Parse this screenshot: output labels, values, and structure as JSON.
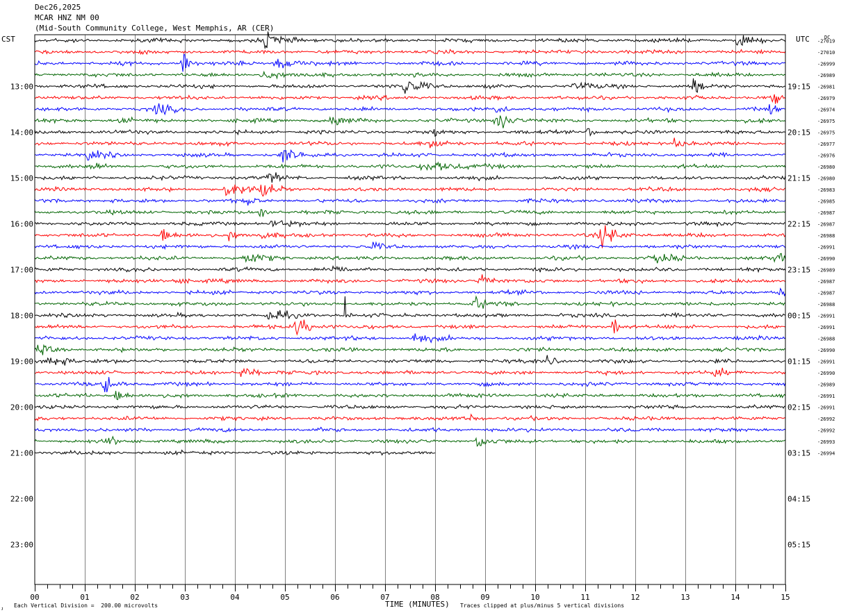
{
  "header": {
    "date": "Dec26,2025",
    "station": "MCAR HNZ NM 00",
    "location": "(Mid-South Community College, West Memphis, AR (CER)"
  },
  "left_axis_label": "CST",
  "right_axis_label": "UTC",
  "dc_label": "DC",
  "footer": {
    "scale_note": "Each Vertical Division =  200.00 microvolts",
    "xlabel": "TIME (MINUTES)",
    "clip_note": "Traces clipped at plus/minus 5 vertical divisions",
    "corner_mark": "ᴊ"
  },
  "colors": {
    "trace_cycle": [
      "#000000",
      "#ff0000",
      "#0000ff",
      "#006400"
    ],
    "grid": "#808080",
    "frame": "#000000"
  },
  "chart_data": {
    "type": "line",
    "title": "",
    "xlabel": "TIME (MINUTES)",
    "xlim": [
      0,
      15
    ],
    "x_ticks": [
      "00",
      "01",
      "02",
      "03",
      "04",
      "05",
      "06",
      "07",
      "08",
      "09",
      "10",
      "11",
      "12",
      "13",
      "14",
      "15"
    ],
    "rows_total": 48,
    "minutes_per_row": 15,
    "left_hour_labels": [
      {
        "row": 4,
        "label": "13:00"
      },
      {
        "row": 8,
        "label": "14:00"
      },
      {
        "row": 12,
        "label": "15:00"
      },
      {
        "row": 16,
        "label": "16:00"
      },
      {
        "row": 20,
        "label": "17:00"
      },
      {
        "row": 24,
        "label": "18:00"
      },
      {
        "row": 28,
        "label": "19:00"
      },
      {
        "row": 32,
        "label": "20:00"
      },
      {
        "row": 36,
        "label": "21:00"
      },
      {
        "row": 40,
        "label": "22:00"
      },
      {
        "row": 44,
        "label": "23:00"
      }
    ],
    "right_hour_labels": [
      {
        "row": 4,
        "label": "19:15"
      },
      {
        "row": 8,
        "label": "20:15"
      },
      {
        "row": 12,
        "label": "21:15"
      },
      {
        "row": 16,
        "label": "22:15"
      },
      {
        "row": 20,
        "label": "23:15"
      },
      {
        "row": 24,
        "label": "00:15"
      },
      {
        "row": 28,
        "label": "01:15"
      },
      {
        "row": 32,
        "label": "02:15"
      },
      {
        "row": 36,
        "label": "03:15"
      },
      {
        "row": 40,
        "label": "04:15"
      },
      {
        "row": 44,
        "label": "05:15"
      }
    ],
    "dc_offsets": [
      "-27019",
      "-27010",
      "-26999",
      "-26989",
      "-26981",
      "-26979",
      "-26974",
      "-26975",
      "-26975",
      "-26977",
      "-26976",
      "-26980",
      "-26980",
      "-26983",
      "-26985",
      "-26987",
      "-26987",
      "-26988",
      "-26991",
      "-26990",
      "-26989",
      "-26987",
      "-26987",
      "-26988",
      "-26991",
      "-26991",
      "-26988",
      "-26990",
      "-26991",
      "-26990",
      "-26989",
      "-26991",
      "-26991",
      "-26992",
      "-26992",
      "-26993",
      "-26994"
    ],
    "traces_drawn": 37,
    "last_trace_end_minute": 8.0,
    "events": [
      {
        "row": 0,
        "minute": 4.65,
        "amp": 0.9,
        "dur": 0.35
      },
      {
        "row": 0,
        "minute": 14.05,
        "amp": 0.7,
        "dur": 0.2
      },
      {
        "row": 2,
        "minute": 2.95,
        "amp": 1.6,
        "dur": 0.15
      },
      {
        "row": 2,
        "minute": 4.85,
        "amp": 0.8,
        "dur": 0.3
      },
      {
        "row": 3,
        "minute": 4.6,
        "amp": 0.6,
        "dur": 0.3
      },
      {
        "row": 4,
        "minute": 7.35,
        "amp": 1.2,
        "dur": 0.35
      },
      {
        "row": 4,
        "minute": 13.15,
        "amp": 0.9,
        "dur": 0.2
      },
      {
        "row": 4,
        "minute": 10.8,
        "amp": 0.5,
        "dur": 0.3
      },
      {
        "row": 5,
        "minute": 14.8,
        "amp": 0.6,
        "dur": 0.3
      },
      {
        "row": 6,
        "minute": 2.45,
        "amp": 0.9,
        "dur": 0.2
      },
      {
        "row": 6,
        "minute": 14.75,
        "amp": 0.9,
        "dur": 0.3
      },
      {
        "row": 6,
        "minute": 9.2,
        "amp": 0.6,
        "dur": 0.2
      },
      {
        "row": 7,
        "minute": 9.25,
        "amp": 1.3,
        "dur": 0.25
      },
      {
        "row": 7,
        "minute": 5.95,
        "amp": 0.6,
        "dur": 0.3
      },
      {
        "row": 7,
        "minute": 1.7,
        "amp": 0.5,
        "dur": 0.2
      },
      {
        "row": 8,
        "minute": 7.95,
        "amp": 0.6,
        "dur": 0.15
      },
      {
        "row": 8,
        "minute": 11.05,
        "amp": 0.6,
        "dur": 0.15
      },
      {
        "row": 9,
        "minute": 7.95,
        "amp": 0.7,
        "dur": 0.3
      },
      {
        "row": 9,
        "minute": 12.75,
        "amp": 0.7,
        "dur": 0.2
      },
      {
        "row": 10,
        "minute": 4.95,
        "amp": 0.8,
        "dur": 0.3
      },
      {
        "row": 10,
        "minute": 1.05,
        "amp": 0.5,
        "dur": 0.3
      },
      {
        "row": 11,
        "minute": 7.85,
        "amp": 0.6,
        "dur": 0.6
      },
      {
        "row": 11,
        "minute": 1.15,
        "amp": 0.4,
        "dur": 0.2
      },
      {
        "row": 12,
        "minute": 4.7,
        "amp": 0.6,
        "dur": 0.25
      },
      {
        "row": 13,
        "minute": 3.85,
        "amp": 1.3,
        "dur": 0.3
      },
      {
        "row": 13,
        "minute": 4.55,
        "amp": 1.0,
        "dur": 0.25
      },
      {
        "row": 14,
        "minute": 4.25,
        "amp": 0.5,
        "dur": 0.15
      },
      {
        "row": 15,
        "minute": 4.5,
        "amp": 0.6,
        "dur": 0.2
      },
      {
        "row": 16,
        "minute": 4.75,
        "amp": 0.5,
        "dur": 0.3
      },
      {
        "row": 17,
        "minute": 2.55,
        "amp": 0.9,
        "dur": 0.2
      },
      {
        "row": 17,
        "minute": 3.9,
        "amp": 0.6,
        "dur": 0.2
      },
      {
        "row": 17,
        "minute": 4.55,
        "amp": 0.5,
        "dur": 0.2
      },
      {
        "row": 17,
        "minute": 11.35,
        "amp": 1.1,
        "dur": 0.35
      },
      {
        "row": 18,
        "minute": 6.75,
        "amp": 0.4,
        "dur": 0.2
      },
      {
        "row": 19,
        "minute": 4.2,
        "amp": 0.7,
        "dur": 0.3
      },
      {
        "row": 19,
        "minute": 12.45,
        "amp": 0.7,
        "dur": 0.3
      },
      {
        "row": 19,
        "minute": 14.8,
        "amp": 1.1,
        "dur": 0.2
      },
      {
        "row": 20,
        "minute": 5.95,
        "amp": 0.9,
        "dur": 0.15
      },
      {
        "row": 21,
        "minute": 8.9,
        "amp": 0.9,
        "dur": 0.2
      },
      {
        "row": 21,
        "minute": 2.8,
        "amp": 0.5,
        "dur": 0.2
      },
      {
        "row": 22,
        "minute": 14.8,
        "amp": 0.6,
        "dur": 0.3
      },
      {
        "row": 23,
        "minute": 8.8,
        "amp": 0.7,
        "dur": 0.25
      },
      {
        "row": 24,
        "minute": 6.2,
        "amp": 2.0,
        "dur": 0.05
      },
      {
        "row": 24,
        "minute": 4.7,
        "amp": 0.7,
        "dur": 0.3
      },
      {
        "row": 25,
        "minute": 5.25,
        "amp": 1.1,
        "dur": 0.3
      },
      {
        "row": 25,
        "minute": 11.55,
        "amp": 1.3,
        "dur": 0.15
      },
      {
        "row": 26,
        "minute": 7.6,
        "amp": 0.8,
        "dur": 0.25
      },
      {
        "row": 27,
        "minute": 0.1,
        "amp": 0.8,
        "dur": 0.2
      },
      {
        "row": 28,
        "minute": 0.3,
        "amp": 0.7,
        "dur": 0.4
      },
      {
        "row": 28,
        "minute": 10.25,
        "amp": 0.5,
        "dur": 0.2
      },
      {
        "row": 29,
        "minute": 4.15,
        "amp": 0.8,
        "dur": 0.25
      },
      {
        "row": 29,
        "minute": 13.6,
        "amp": 0.4,
        "dur": 0.3
      },
      {
        "row": 30,
        "minute": 1.4,
        "amp": 1.1,
        "dur": 0.2
      },
      {
        "row": 31,
        "minute": 1.65,
        "amp": 0.9,
        "dur": 0.2
      },
      {
        "row": 33,
        "minute": 8.7,
        "amp": 0.6,
        "dur": 0.15
      },
      {
        "row": 35,
        "minute": 8.85,
        "amp": 0.9,
        "dur": 0.2
      },
      {
        "row": 35,
        "minute": 1.5,
        "amp": 0.4,
        "dur": 0.2
      }
    ]
  }
}
